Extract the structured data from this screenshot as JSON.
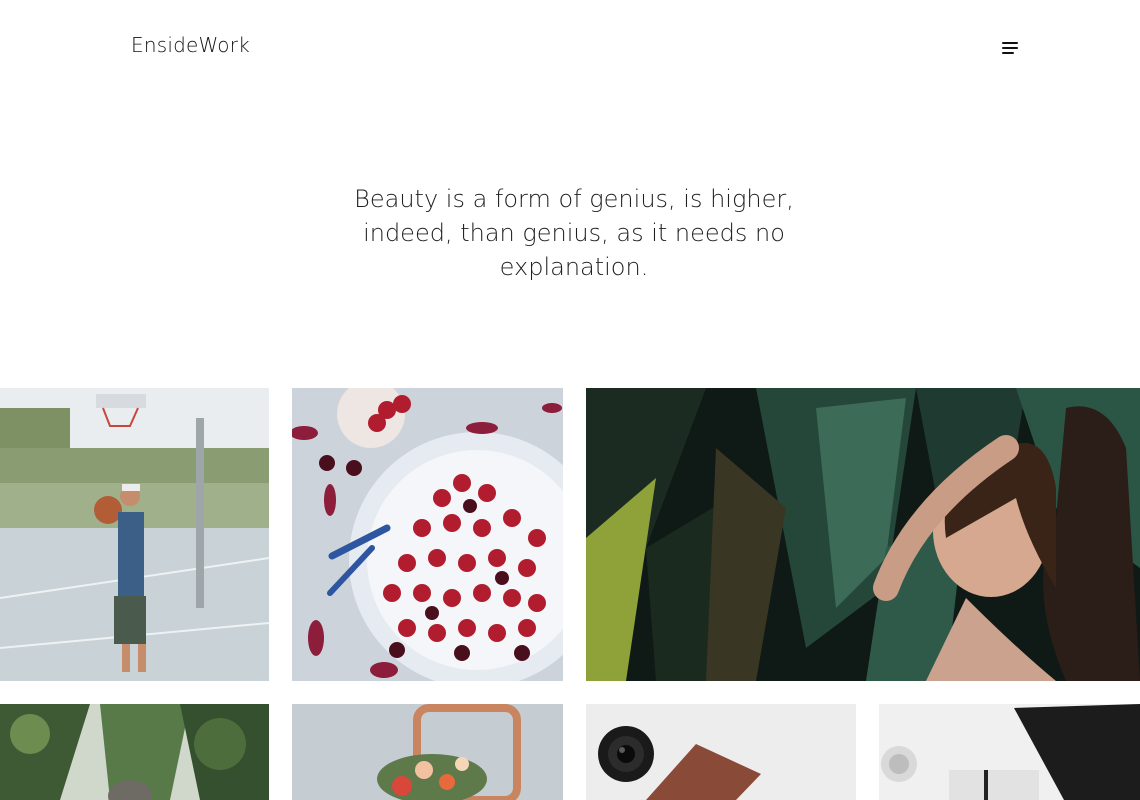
{
  "header": {
    "logo": "EnsideWork",
    "menu_icon": "hamburger-menu-icon"
  },
  "hero": {
    "quote": "Beauty is a form of genius, is higher, indeed, than genius, as it needs no explanation."
  },
  "gallery": {
    "items": [
      {
        "subject": "basketball-player-photo"
      },
      {
        "subject": "cherries-plate-photo"
      },
      {
        "subject": "woman-palm-leaves-photo"
      },
      {
        "subject": "plants-greenhouse-photo"
      },
      {
        "subject": "flowers-chair-photo"
      },
      {
        "subject": "camera-lens-book-photo"
      },
      {
        "subject": "studio-light-photo"
      }
    ]
  }
}
